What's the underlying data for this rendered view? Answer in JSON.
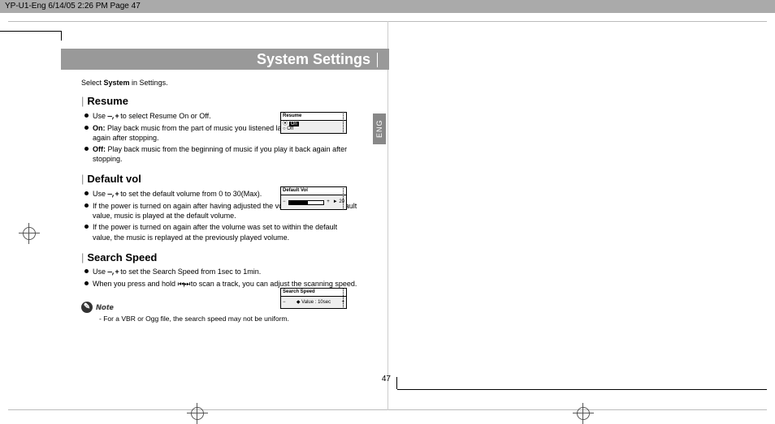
{
  "header": {
    "slug": "YP-U1-Eng  6/14/05 2:26 PM  Page 47"
  },
  "page": {
    "title": "System Settings",
    "intro_pre": "Select ",
    "intro_bold": "System",
    "intro_post": " in Settings.",
    "lang_tab": "ENG",
    "number": "47"
  },
  "sections": {
    "resume": {
      "title": "Resume",
      "use_pre": "Use ",
      "pm": "—,+",
      "use_post": " to select Resume On or Off.",
      "on_label": "On:",
      "on_text": " Play back music from the part of music you listened last if you play it back again after stopping.",
      "off_label": "Off:",
      "off_text": " Play back music from the beginning of music if you play it back again after stopping."
    },
    "defaultvol": {
      "title": "Default vol",
      "use_pre": "Use ",
      "pm": "—,+",
      "use_post": " to set the default volume from 0 to 30(Max).",
      "b2": "If the power is turned on again after having adjusted the volume above the default value, music is played at the default volume.",
      "b3": "If the power is turned on again after the volume was set to within the default value, the music is replayed at the previously played volume."
    },
    "searchspeed": {
      "title": "Search Speed",
      "use_pre": "Use ",
      "pm": "—,+",
      "use_post": " to set the Search Speed from 1sec to 1min.",
      "b2_pre": "When you press and hold ",
      "b2_icons": "⏮ , ⏭",
      "b2_post": " to scan a track, you can  adjust the scanning speed."
    }
  },
  "devices": {
    "resume": {
      "title": "Resume",
      "opt_on": "On",
      "opt_off": "Off",
      "radio": "⦿",
      "radio_off": "○"
    },
    "defaultvol": {
      "title": "Default Vol",
      "value_label": "► 20",
      "minus": "−",
      "plus": "+"
    },
    "searchspeed": {
      "title": "Search Speed",
      "line": "◆ Value : 10sec",
      "minus": "−",
      "plus": "+"
    }
  },
  "note": {
    "badge": "✎",
    "label": "Note",
    "text": "- For a VBR or Ogg file, the search speed may not be uniform."
  }
}
